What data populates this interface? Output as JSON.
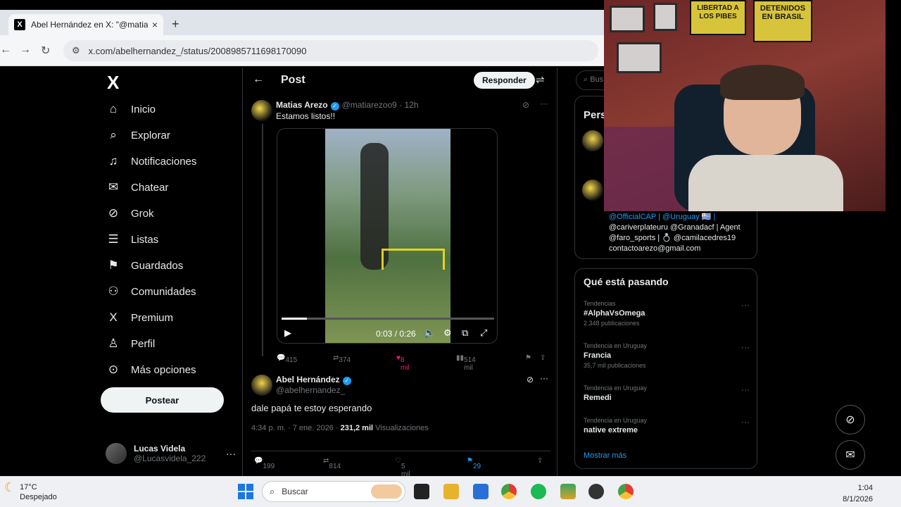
{
  "browser": {
    "tab_title": "Abel Hernández en X: \"@matiar",
    "tab_close": "×",
    "new_tab": "+",
    "url": "x.com/abelhernandez_/status/2008985711698170090"
  },
  "nav": {
    "logo": "X",
    "items": [
      {
        "label": "Inicio",
        "icon": "⌂"
      },
      {
        "label": "Explorar",
        "icon": "⌕"
      },
      {
        "label": "Notificaciones",
        "icon": "♫"
      },
      {
        "label": "Chatear",
        "icon": "✉"
      },
      {
        "label": "Grok",
        "icon": "⊘"
      },
      {
        "label": "Listas",
        "icon": "☰"
      },
      {
        "label": "Guardados",
        "icon": "⚑"
      },
      {
        "label": "Comunidades",
        "icon": "⚇"
      },
      {
        "label": "Premium",
        "icon": "X"
      },
      {
        "label": "Perfil",
        "icon": "♙"
      },
      {
        "label": "Más opciones",
        "icon": "⊙"
      }
    ],
    "post_button": "Postear",
    "user": {
      "name": "Lucas Videla",
      "handle": "@Lucasvidela_222"
    }
  },
  "main": {
    "header_title": "Post",
    "reply_button": "Responder",
    "quoted": {
      "name": "Matias Arezo",
      "handle": "@matiarezoo9",
      "time": "12h",
      "text": "Estamos listos!!",
      "video_time": "0:03 / 0:26",
      "video_progress": 0.12,
      "replies": "415",
      "reposts": "374",
      "likes": "8 mil",
      "views": "514 mil"
    },
    "tweet": {
      "name": "Abel Hernández",
      "handle": "@abelhernandez_",
      "text": "dale papá te estoy esperando",
      "date": "4:34 p. m. · 7 ene. 2026 ·",
      "views": "231,2 mil",
      "views_label": "Visualizaciones",
      "replies": "199",
      "reposts": "814",
      "likes": "5 mil",
      "bookmarks": "29"
    }
  },
  "right": {
    "search_placeholder": "Bus",
    "pers_title": "Pers",
    "bio_lines": [
      "@OfficialCAP | @Uruguay 🇺🇾 |",
      "@cariverplateuru @Granadacf | Agent",
      "@faro_sports | 💍 @camilacedres19",
      "contactoarezo@gmail.com"
    ],
    "trends_title": "Qué está pasando",
    "trends": [
      {
        "context": "Tendencias",
        "name": "#AlphaVsOmega",
        "count": "2.348 publicaciones"
      },
      {
        "context": "Tendencia en Uruguay",
        "name": "Francia",
        "count": "35,7 mil publicaciones"
      },
      {
        "context": "Tendencia en Uruguay",
        "name": "Remedi",
        "count": ""
      },
      {
        "context": "Tendencia en Uruguay",
        "name": "native extreme",
        "count": ""
      }
    ],
    "show_more": "Mostrar más"
  },
  "webcam": {
    "sign1": "LIBERTAD A LOS PIBES",
    "sign2": "DETENIDOS EN BRASIL"
  },
  "taskbar": {
    "temp": "17°C",
    "weather": "Despejado",
    "search": "Buscar",
    "time": "1:04",
    "date": "8/1/2026"
  },
  "colors": {
    "accent": "#1d9bf0",
    "like": "#f91880",
    "bookmark": "#1d9bf0"
  }
}
